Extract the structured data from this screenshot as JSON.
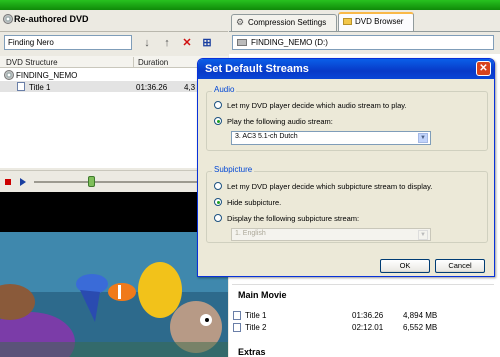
{
  "left": {
    "title": "Re-authored DVD",
    "name_input": "Finding Nero",
    "tree": {
      "col_structure": "DVD Structure",
      "col_duration": "Duration",
      "root": "FINDING_NEMO",
      "child": {
        "label": "Title 1",
        "duration": "01:36.26",
        "size": "4,3"
      }
    }
  },
  "right": {
    "tabs": [
      "Compression Settings",
      "DVD Browser"
    ],
    "path": "FINDING_NEMO (D:)",
    "main_movie": "Main Movie",
    "rows": [
      {
        "label": "Title 1",
        "duration": "01:36.26",
        "size": "4,894 MB"
      },
      {
        "label": "Title 2",
        "duration": "02:12.01",
        "size": "6,552 MB"
      }
    ],
    "extras": "Extras"
  },
  "dialog": {
    "title": "Set Default Streams",
    "audio": {
      "legend": "Audio",
      "opt1": "Let my DVD player decide which audio stream to play.",
      "opt2": "Play the following audio stream:",
      "selected": "3. AC3 5.1-ch Dutch"
    },
    "subpicture": {
      "legend": "Subpicture",
      "opt1": "Let my DVD player decide which subpicture stream to display.",
      "opt2": "Hide subpicture.",
      "opt3": "Display the following subpicture stream:",
      "selected": "1. English"
    },
    "ok": "OK",
    "cancel": "Cancel"
  },
  "colors": {
    "titlebar": "#0839c7",
    "close": "#d8431c",
    "legend": "#0046d5",
    "top_bar": "#1aa614"
  }
}
